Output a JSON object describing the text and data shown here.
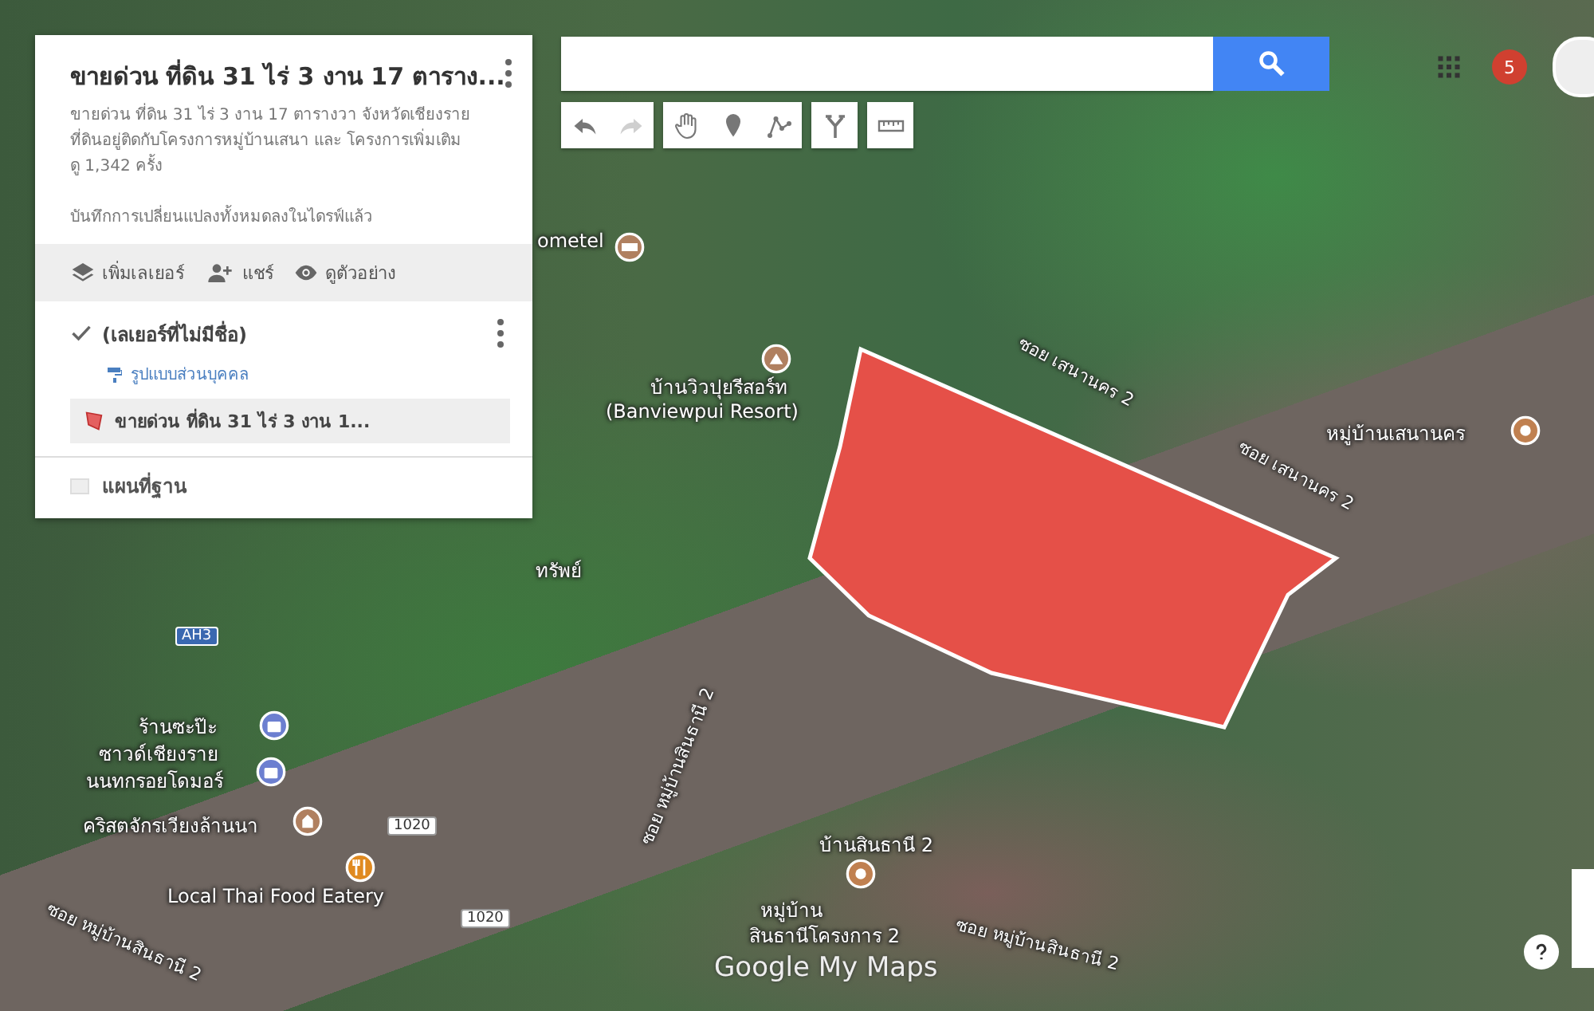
{
  "panel": {
    "title": "ขายด่วน ที่ดิน 31 ไร่ 3 งาน 17 ตาราง...",
    "description": [
      "ขายด่วน ที่ดิน 31 ไร่ 3 งาน 17 ตารางวา จังหวัดเชียงราย",
      "ที่ดินอยู่ติดกับโครงการหมู่บ้านเสนา และ โครงการเพิ่มเติม"
    ],
    "views": "ดู 1,342 ครั้ง",
    "save_status": "บันทึกการเปลี่ยนแปลงทั้งหมดลงในไดรฟ์แล้ว",
    "actions": [
      {
        "kind": "add-layer",
        "label": "เพิ่มเลเยอร์"
      },
      {
        "kind": "share",
        "label": "แชร์"
      },
      {
        "kind": "preview",
        "label": "ดูตัวอย่าง"
      }
    ],
    "layers": [
      {
        "name": "(เลเยอร์ที่ไม่มีชื่อ)",
        "checked": true,
        "style_label": "รูปแบบส่วนบุคคล",
        "features": [
          {
            "label": "ขายด่วน ที่ดิน 31 ไร่ 3 งาน 1...",
            "selected": true
          }
        ]
      }
    ],
    "base_map": {
      "label": "แผนที่ฐาน"
    }
  },
  "tools": [
    {
      "kind": "undo",
      "disabled": false
    },
    {
      "kind": "redo",
      "disabled": true
    },
    {
      "kind": "hand",
      "disabled": false
    },
    {
      "kind": "marker",
      "disabled": false
    },
    {
      "kind": "line",
      "disabled": false
    },
    {
      "kind": "route",
      "disabled": false
    },
    {
      "kind": "ruler",
      "disabled": false
    }
  ],
  "notifications": {
    "count": "5"
  },
  "map": {
    "markers": [
      {
        "kind": "hotel"
      },
      {
        "kind": "resort"
      },
      {
        "kind": "place"
      },
      {
        "kind": "shop"
      },
      {
        "kind": "shop"
      },
      {
        "kind": "church"
      },
      {
        "kind": "restaurant"
      },
      {
        "kind": "place"
      }
    ],
    "labels": [
      {
        "text": "ometel",
        "kind": "place"
      },
      {
        "text": "บ้านวิวปุยรีสอร์ท",
        "kind": "place"
      },
      {
        "text": "(Banviewpui Resort)",
        "kind": "place"
      },
      {
        "text": "ซอย เสนานคร 2",
        "kind": "road"
      },
      {
        "text": "ซอย เสนานคร 2",
        "kind": "road"
      },
      {
        "text": "หมู่บ้านเสนานคร",
        "kind": "place"
      },
      {
        "text": "ทรัพย์",
        "kind": "place"
      },
      {
        "text": "AH3",
        "kind": "shield"
      },
      {
        "text": "ร้านซะป๊ะ",
        "kind": "place"
      },
      {
        "text": "ซาวด์เชียงราย",
        "kind": "place"
      },
      {
        "text": "นนทกรอยโดมอร์",
        "kind": "place"
      },
      {
        "text": "คริสตจักรเวียงล้านนา",
        "kind": "place"
      },
      {
        "text": "1020",
        "kind": "shield"
      },
      {
        "text": "1020",
        "kind": "shield"
      },
      {
        "text": "Local Thai Food Eatery",
        "kind": "place"
      },
      {
        "text": "บ้านสินธานี 2",
        "kind": "place"
      },
      {
        "text": "หมู่บ้าน",
        "kind": "place"
      },
      {
        "text": "สินธานีโครงการ 2",
        "kind": "place"
      },
      {
        "text": "ซอย หมู่บ้านสินธานี 2",
        "kind": "road"
      },
      {
        "text": "ซอย หมู่บ้านสินธานี 2",
        "kind": "road"
      },
      {
        "text": "ซอย หมู่บ้านสินธานี 2",
        "kind": "road"
      }
    ],
    "logo": "Google My Maps"
  }
}
